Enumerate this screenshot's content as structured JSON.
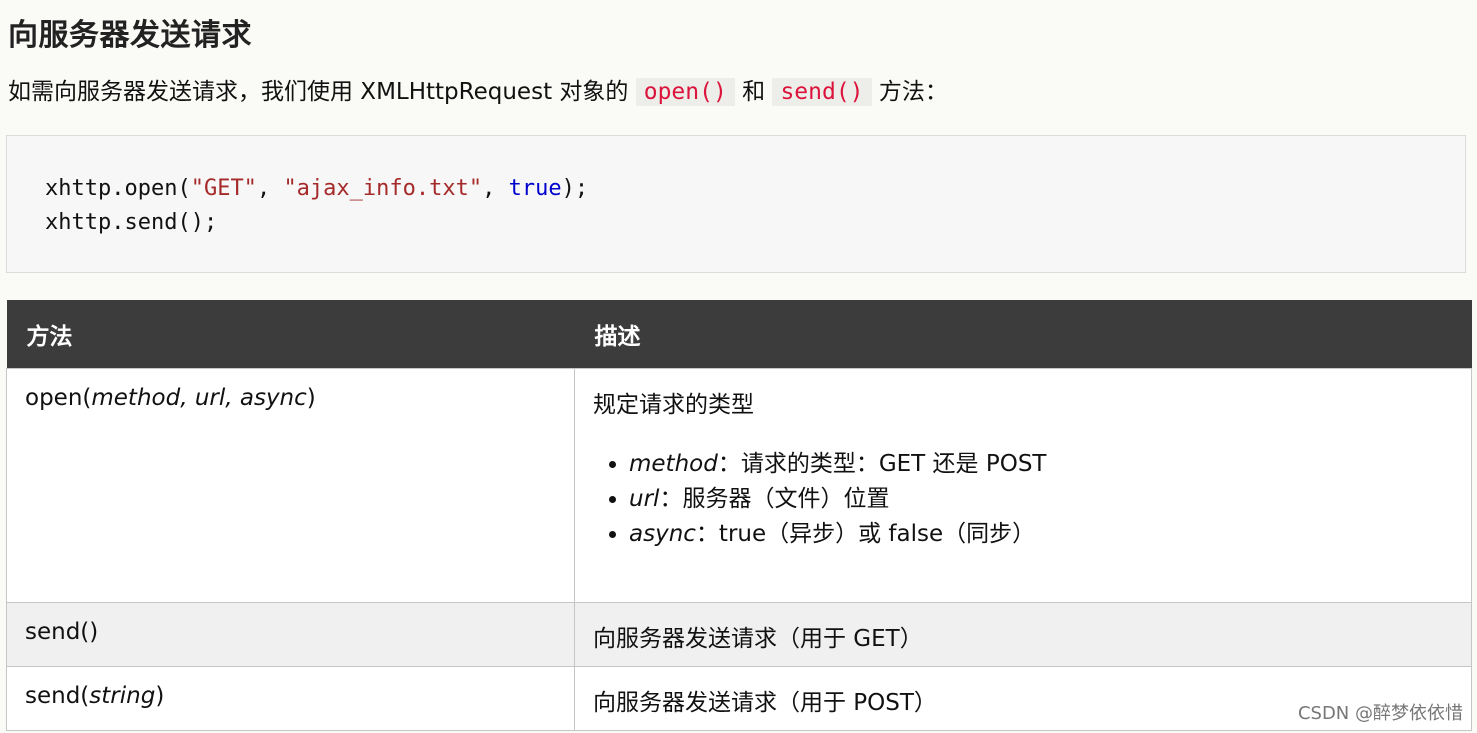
{
  "heading": "向服务器发送请求",
  "intro": {
    "prefix": "如需向服务器发送请求，我们使用 XMLHttpRequest 对象的 ",
    "code1": "open()",
    "middle": " 和 ",
    "code2": "send()",
    "suffix": " 方法："
  },
  "code": {
    "line1": {
      "t1": "xhttp.open(",
      "s1": "\"GET\"",
      "t2": ", ",
      "s2": "\"ajax_info.txt\"",
      "t3": ", ",
      "kw": "true",
      "t4": ");"
    },
    "line2": "xhttp.send();"
  },
  "table": {
    "headers": [
      "方法",
      "描述"
    ],
    "rows": [
      {
        "method_prefix": "open(",
        "method_args": "method, url, async",
        "method_suffix": ")",
        "desc": "规定请求的类型",
        "params": [
          {
            "name": "method",
            "text": "：请求的类型：GET 还是 POST"
          },
          {
            "name": "url",
            "text": "：服务器（文件）位置"
          },
          {
            "name": "async",
            "text": "：true（异步）或 false（同步）"
          }
        ]
      },
      {
        "method": "send()",
        "desc": "向服务器发送请求（用于 GET）"
      },
      {
        "method_prefix": "send(",
        "method_args": "string",
        "method_suffix": ")",
        "desc": "向服务器发送请求（用于 POST）"
      }
    ]
  },
  "watermark": "CSDN @醉梦依依惜"
}
